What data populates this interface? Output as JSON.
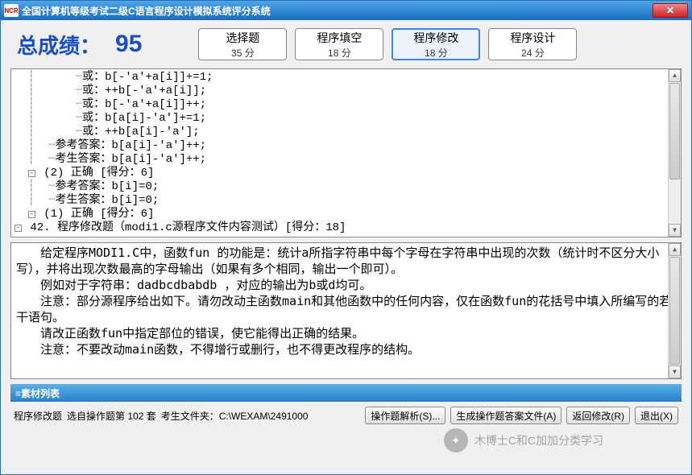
{
  "titlebar": {
    "logo": "NCR",
    "title": "全国计算机等级考试二级C语言程序设计模拟系统评分系统"
  },
  "score": {
    "label": "总成绩：",
    "value": "95"
  },
  "categories": [
    {
      "name": "选择题",
      "sub": "35 分"
    },
    {
      "name": "程序填空",
      "sub": "18 分"
    },
    {
      "name": "程序修改",
      "sub": "18 分"
    },
    {
      "name": "程序设计",
      "sub": "24 分"
    }
  ],
  "tree": [
    {
      "toggle": "-",
      "indent": "",
      "text": "42. 程序修改题（modi1.c源程序文件内容测试）[得分：18]"
    },
    {
      "toggle": "-",
      "indent": "  ",
      "text": "(1) 正确 [得分：6]"
    },
    {
      "toggle": "",
      "indent": "  │  ",
      "text": "考生答案：b[i]=0;"
    },
    {
      "toggle": "",
      "indent": "  │  ",
      "text": "参考答案：b[i]=0;"
    },
    {
      "toggle": "-",
      "indent": "  ",
      "text": "(2) 正确 [得分：6]"
    },
    {
      "toggle": "",
      "indent": "  │  ",
      "text": "考生答案：b[a[i]-'a']++;"
    },
    {
      "toggle": "",
      "indent": "  │  ",
      "text": "参考答案：b[a[i]-'a']++;"
    },
    {
      "toggle": "",
      "indent": "  │      ",
      "text": "或：++b[a[i]-'a'];"
    },
    {
      "toggle": "",
      "indent": "  │      ",
      "text": "或：b[a[i]-'a']+=1;"
    },
    {
      "toggle": "",
      "indent": "  │      ",
      "text": "或：b[-'a'+a[i]]++;"
    },
    {
      "toggle": "",
      "indent": "  │      ",
      "text": "或：++b[-'a'+a[i]];"
    },
    {
      "toggle": "",
      "indent": "  │      ",
      "text": "或：b[-'a'+a[i]]+=1;"
    }
  ],
  "description": [
    "给定程序MODI1.C中，函数fun 的功能是：统计a所指字符串中每个字母在字符串中出现的次数（统计时不区分大小写），并将出现次数最高的字母输出（如果有多个相同，输出一个即可）。",
    "例如对于字符串：dadbcdbabdb ，对应的输出为b或d均可。",
    "注意：部分源程序给出如下。请勿改动主函数main和其他函数中的任何内容，仅在函数fun的花括号中填入所编写的若干语句。",
    "请改正函数fun中指定部位的错误，使它能得出正确的结果。",
    "注意：不要改动main函数，不得增行或删行，也不得更改程序的结构。"
  ],
  "material_bar": "≡素材列表",
  "status": {
    "left1": "程序修改题",
    "left2": "选自操作题第 102 套",
    "left3": "考生文件夹：C:\\WEXAM\\2491000"
  },
  "buttons": {
    "parse": "操作题解析(S)...",
    "gen": "生成操作题答案文件(A)",
    "back": "返回修改(R)",
    "exit": "退出(X)"
  },
  "watermark": "木博士C和C加加分类学习"
}
